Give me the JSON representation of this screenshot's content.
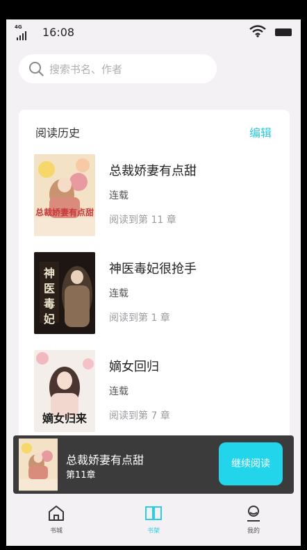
{
  "status_bar": {
    "network": "4G",
    "time": "16:08"
  },
  "search": {
    "placeholder": "搜索书名、作者"
  },
  "history": {
    "title": "阅读历史",
    "edit_label": "编辑",
    "books": [
      {
        "title": "总裁娇妻有点甜",
        "status": "连载",
        "progress": "阅读到第 11 章",
        "cover_text": "总裁娇妻有点甜"
      },
      {
        "title": "神医毒妃很抢手",
        "status": "连载",
        "progress": "阅读到第 1 章",
        "cover_text": "神医毒妃"
      },
      {
        "title": "嫡女回归",
        "status": "连载",
        "progress": "阅读到第 7 章",
        "cover_text": "嫡女归来"
      }
    ]
  },
  "now_reading": {
    "title": "总裁娇妻有点甜",
    "chapter": "第11章",
    "continue_label": "继续阅读"
  },
  "tabs": [
    {
      "label": "书城",
      "icon": "home-icon",
      "active": false
    },
    {
      "label": "书架",
      "icon": "book-open-icon",
      "active": true
    },
    {
      "label": "我的",
      "icon": "user-icon",
      "active": false
    }
  ],
  "colors": {
    "accent": "#2bcce6",
    "button": "#23d5ea",
    "player_bg": "#3b3b3b",
    "page_bg": "#f4f1f5"
  }
}
